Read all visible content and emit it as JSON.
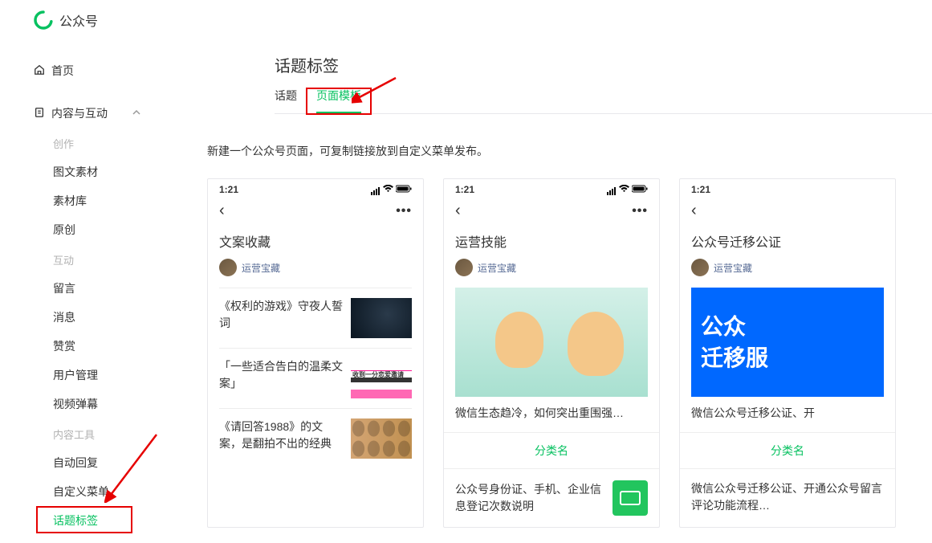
{
  "header": {
    "app_name": "公众号"
  },
  "sidebar": {
    "home": "首页",
    "section_title": "内容与互动",
    "groups": [
      {
        "label": "创作",
        "items": [
          "图文素材",
          "素材库",
          "原创"
        ]
      },
      {
        "label": "互动",
        "items": [
          "留言",
          "消息",
          "赞赏",
          "用户管理",
          "视频弹幕"
        ]
      },
      {
        "label": "内容工具",
        "items": [
          "自动回复",
          "自定义菜单",
          "话题标签"
        ],
        "active_index": 2
      }
    ]
  },
  "main": {
    "title": "话题标签",
    "tabs": [
      "话题",
      "页面模板"
    ],
    "active_tab_index": 1,
    "hint": "新建一个公众号页面，可复制链接放到自定义菜单发布。",
    "phone_time": "1:21",
    "cards": [
      {
        "title": "文案收藏",
        "author": "运营宝藏",
        "articles": [
          "《权利的游戏》守夜人誓词",
          "「一些适合告白的温柔文案」",
          "《请回答1988》的文案，是翻拍不出的经典"
        ]
      },
      {
        "title": "运营技能",
        "author": "运营宝藏",
        "hero_caption": "微信生态趋冷，如何突出重围强…",
        "category_label": "分类名",
        "sub_text": "公众号身份证、手机、企业信息登记次数说明"
      },
      {
        "title": "公众号迁移公证",
        "author": "运营宝藏",
        "hero_line1": "公众",
        "hero_line2": "迁移服",
        "hero_caption": "微信公众号迁移公证、开",
        "category_label": "分类名",
        "sub_text": "微信公众号迁移公证、开通公众号留言评论功能流程…"
      }
    ]
  }
}
